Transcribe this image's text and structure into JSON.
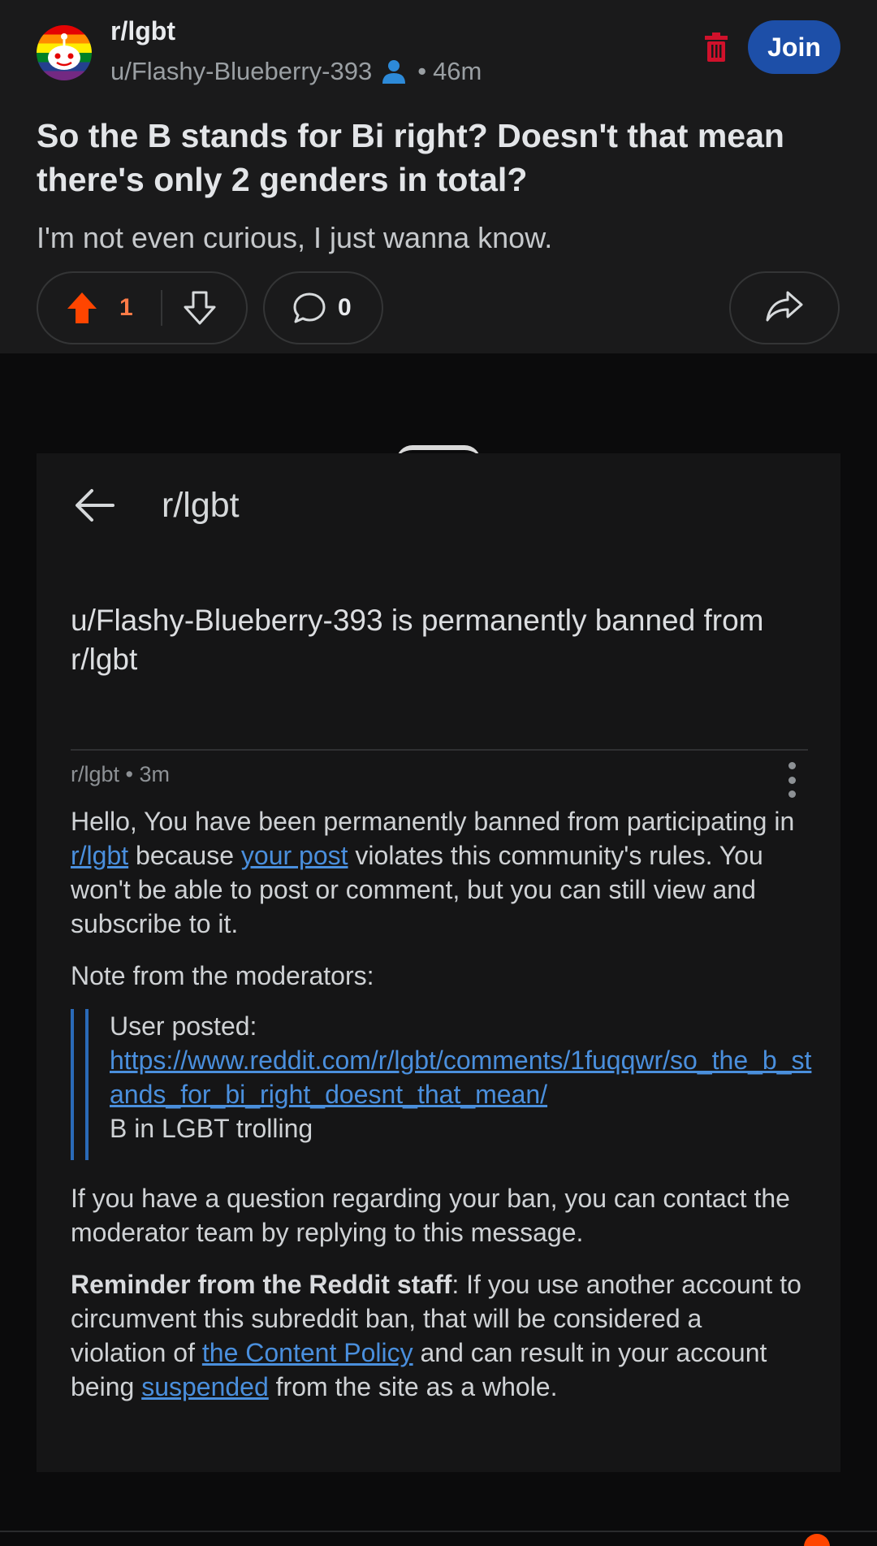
{
  "post": {
    "subreddit": "r/lgbt",
    "author": "u/Flashy-Blueberry-393",
    "separator": "•",
    "age": "46m",
    "join_label": "Join",
    "title": "So the B stands for Bi right? Doesn't that mean there's only 2 genders in total?",
    "body": "I'm not even curious, I just wanna know.",
    "vote_count": "1",
    "comment_count": "0"
  },
  "screenshot": {
    "subreddit": "r/lgbt",
    "heading": "u/Flashy-Blueberry-393 is permanently banned from r/lgbt",
    "meta": "r/lgbt • 3m",
    "p1_a": "Hello, You have been permanently banned from participating in ",
    "p1_link1": "r/lgbt",
    "p1_b": " because ",
    "p1_link2": "your post",
    "p1_c": " violates this community's rules. You won't be able to post or comment, but you can still view and subscribe to it.",
    "note_label": "Note from the moderators:",
    "quote_label": "User posted:",
    "quote_url": "https://www.reddit.com/r/lgbt/comments/1fuqqwr/so_the_b_stands_for_bi_right_doesnt_that_mean/",
    "quote_reason": "B in LGBT trolling",
    "p4": "If you have a question regarding your ban, you can contact the moderator team by replying to this message.",
    "p5_strong": "Reminder from the Reddit staff",
    "p5_a": ": If you use another account to circumvent this subreddit ban, that will be considered a violation of ",
    "p5_link1": "the Content Policy",
    "p5_b": " and can result in your account being ",
    "p5_link2": "suspended",
    "p5_c": " from the site as a whole."
  },
  "colors": {
    "accent_join": "#1d4fa8",
    "upvote": "#ff4500",
    "link": "#4a8fdd",
    "trash": "#d0112b"
  },
  "icons": {
    "upvote": "upvote-arrow-icon",
    "downvote": "downvote-arrow-icon",
    "comment": "comment-bubble-icon",
    "share": "share-arrow-icon",
    "trash": "trash-icon",
    "user": "user-icon",
    "back": "back-arrow-icon",
    "more": "kebab-menu-icon"
  }
}
